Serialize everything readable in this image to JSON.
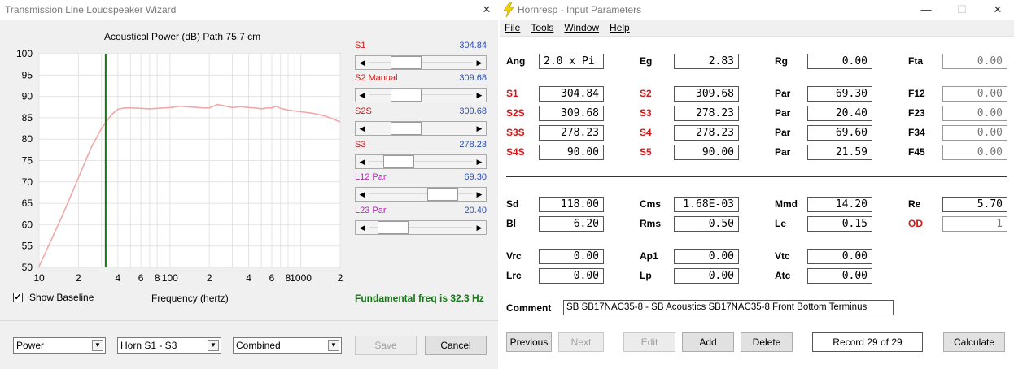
{
  "left_window": {
    "title": "Transmission Line Loudspeaker Wizard",
    "chart_title": "Acoustical Power (dB)   Path 75.7 cm",
    "show_baseline_label": "Show Baseline",
    "show_baseline_checked": "✓",
    "frequency_label": "Frequency (hertz)",
    "fundamental_label": "Fundamental freq is 32.3 Hz",
    "sliders": [
      {
        "name": "S1",
        "value": "304.84",
        "color": "#d01818",
        "thumb": 0.3
      },
      {
        "name": "S2  Manual",
        "value": "309.68",
        "color": "#d01818",
        "thumb": 0.3
      },
      {
        "name": "S2S",
        "value": "309.68",
        "color": "#d01818",
        "thumb": 0.3
      },
      {
        "name": "S3",
        "value": "278.23",
        "color": "#d01818",
        "thumb": 0.2
      },
      {
        "name": "L12  Par",
        "value": "69.30",
        "color": "#c020c0",
        "thumb": 0.8
      },
      {
        "name": "L23  Par",
        "value": "20.40",
        "color": "#c020c0",
        "thumb": 0.12
      }
    ],
    "combos": {
      "mode": "Power",
      "segment": "Horn S1 - S3",
      "view": "Combined"
    },
    "save_label": "Save",
    "cancel_label": "Cancel"
  },
  "chart_data": {
    "type": "line",
    "title": "Acoustical Power (dB)   Path 75.7 cm",
    "xlabel": "Frequency (hertz)",
    "ylabel": "",
    "xscale": "log",
    "xlim": [
      10,
      2000
    ],
    "ylim": [
      50,
      100
    ],
    "yticks": [
      "100",
      "95",
      "90",
      "85",
      "80",
      "75",
      "70",
      "65",
      "60",
      "55",
      "50"
    ],
    "xticks": [
      {
        "v": 10,
        "t": "10"
      },
      {
        "v": 20,
        "t": "2"
      },
      {
        "v": 40,
        "t": "4"
      },
      {
        "v": 60,
        "t": "6"
      },
      {
        "v": 80,
        "t": "8"
      },
      {
        "v": 100,
        "t": "100"
      },
      {
        "v": 200,
        "t": "2"
      },
      {
        "v": 400,
        "t": "4"
      },
      {
        "v": 600,
        "t": "6"
      },
      {
        "v": 800,
        "t": "8"
      },
      {
        "v": 1000,
        "t": "1000"
      },
      {
        "v": 2000,
        "t": "2"
      }
    ],
    "marker_freq": 32.3,
    "line_color": "#f0a8a8",
    "marker_color": "#0a7a0a",
    "grid": true,
    "series": [
      {
        "x": [
          10,
          15,
          20,
          25,
          30,
          33,
          36,
          40,
          45,
          50,
          60,
          70,
          80,
          90,
          100,
          120,
          150,
          180,
          200,
          230,
          260,
          300,
          350,
          400,
          450,
          500,
          550,
          600,
          650,
          700,
          800,
          900,
          1000,
          1200,
          1500,
          1800,
          2000
        ],
        "y": [
          50.2,
          62,
          71,
          78,
          82.5,
          84.3,
          85.8,
          87,
          87.3,
          87.3,
          87.2,
          87.1,
          87.2,
          87.3,
          87.4,
          87.7,
          87.5,
          87.3,
          87.3,
          88.1,
          87.8,
          87.4,
          87.6,
          87.4,
          87.3,
          87.1,
          87.3,
          87.3,
          87.7,
          87.2,
          86.8,
          86.6,
          86.4,
          86.1,
          85.5,
          84.6,
          84
        ]
      }
    ]
  },
  "right_window": {
    "title": "Hornresp - Input Parameters",
    "menu": [
      "File",
      "Tools",
      "Window",
      "Help"
    ],
    "params": {
      "ang": {
        "label": "Ang",
        "value": "2.0 x Pi"
      },
      "eg": {
        "label": "Eg",
        "value": "2.83"
      },
      "rg": {
        "label": "Rg",
        "value": "0.00"
      },
      "fta": {
        "label": "Fta",
        "value": "0.00"
      },
      "s1": {
        "label": "S1",
        "value": "304.84"
      },
      "s2": {
        "label": "S2",
        "value": "309.68"
      },
      "par1": {
        "label": "Par",
        "value": "69.30"
      },
      "f12": {
        "label": "F12",
        "value": "0.00"
      },
      "s2s": {
        "label": "S2S",
        "value": "309.68"
      },
      "s3": {
        "label": "S3",
        "value": "278.23"
      },
      "par2": {
        "label": "Par",
        "value": "20.40"
      },
      "f23": {
        "label": "F23",
        "value": "0.00"
      },
      "s3s": {
        "label": "S3S",
        "value": "278.23"
      },
      "s4": {
        "label": "S4",
        "value": "278.23"
      },
      "par3": {
        "label": "Par",
        "value": "69.60"
      },
      "f34": {
        "label": "F34",
        "value": "0.00"
      },
      "s4s": {
        "label": "S4S",
        "value": "90.00"
      },
      "s5": {
        "label": "S5",
        "value": "90.00"
      },
      "par4": {
        "label": "Par",
        "value": "21.59"
      },
      "f45": {
        "label": "F45",
        "value": "0.00"
      },
      "sd": {
        "label": "Sd",
        "value": "118.00"
      },
      "cms": {
        "label": "Cms",
        "value": "1.68E-03"
      },
      "mmd": {
        "label": "Mmd",
        "value": "14.20"
      },
      "re": {
        "label": "Re",
        "value": "5.70"
      },
      "bl": {
        "label": "Bl",
        "value": "6.20"
      },
      "rms": {
        "label": "Rms",
        "value": "0.50"
      },
      "le": {
        "label": "Le",
        "value": "0.15"
      },
      "od": {
        "label": "OD",
        "value": "1"
      },
      "vrc": {
        "label": "Vrc",
        "value": "0.00"
      },
      "ap1": {
        "label": "Ap1",
        "value": "0.00"
      },
      "vtc": {
        "label": "Vtc",
        "value": "0.00"
      },
      "lrc": {
        "label": "Lrc",
        "value": "0.00"
      },
      "lp": {
        "label": "Lp",
        "value": "0.00"
      },
      "atc": {
        "label": "Atc",
        "value": "0.00"
      }
    },
    "comment_label": "Comment",
    "comment_value": "SB SB17NAC35-8 - SB Acoustics SB17NAC35-8 Front Bottom Terminus",
    "buttons": {
      "previous": "Previous",
      "next": "Next",
      "edit": "Edit",
      "add": "Add",
      "delete": "Delete",
      "record": "Record 29 of 29",
      "calculate": "Calculate"
    }
  }
}
